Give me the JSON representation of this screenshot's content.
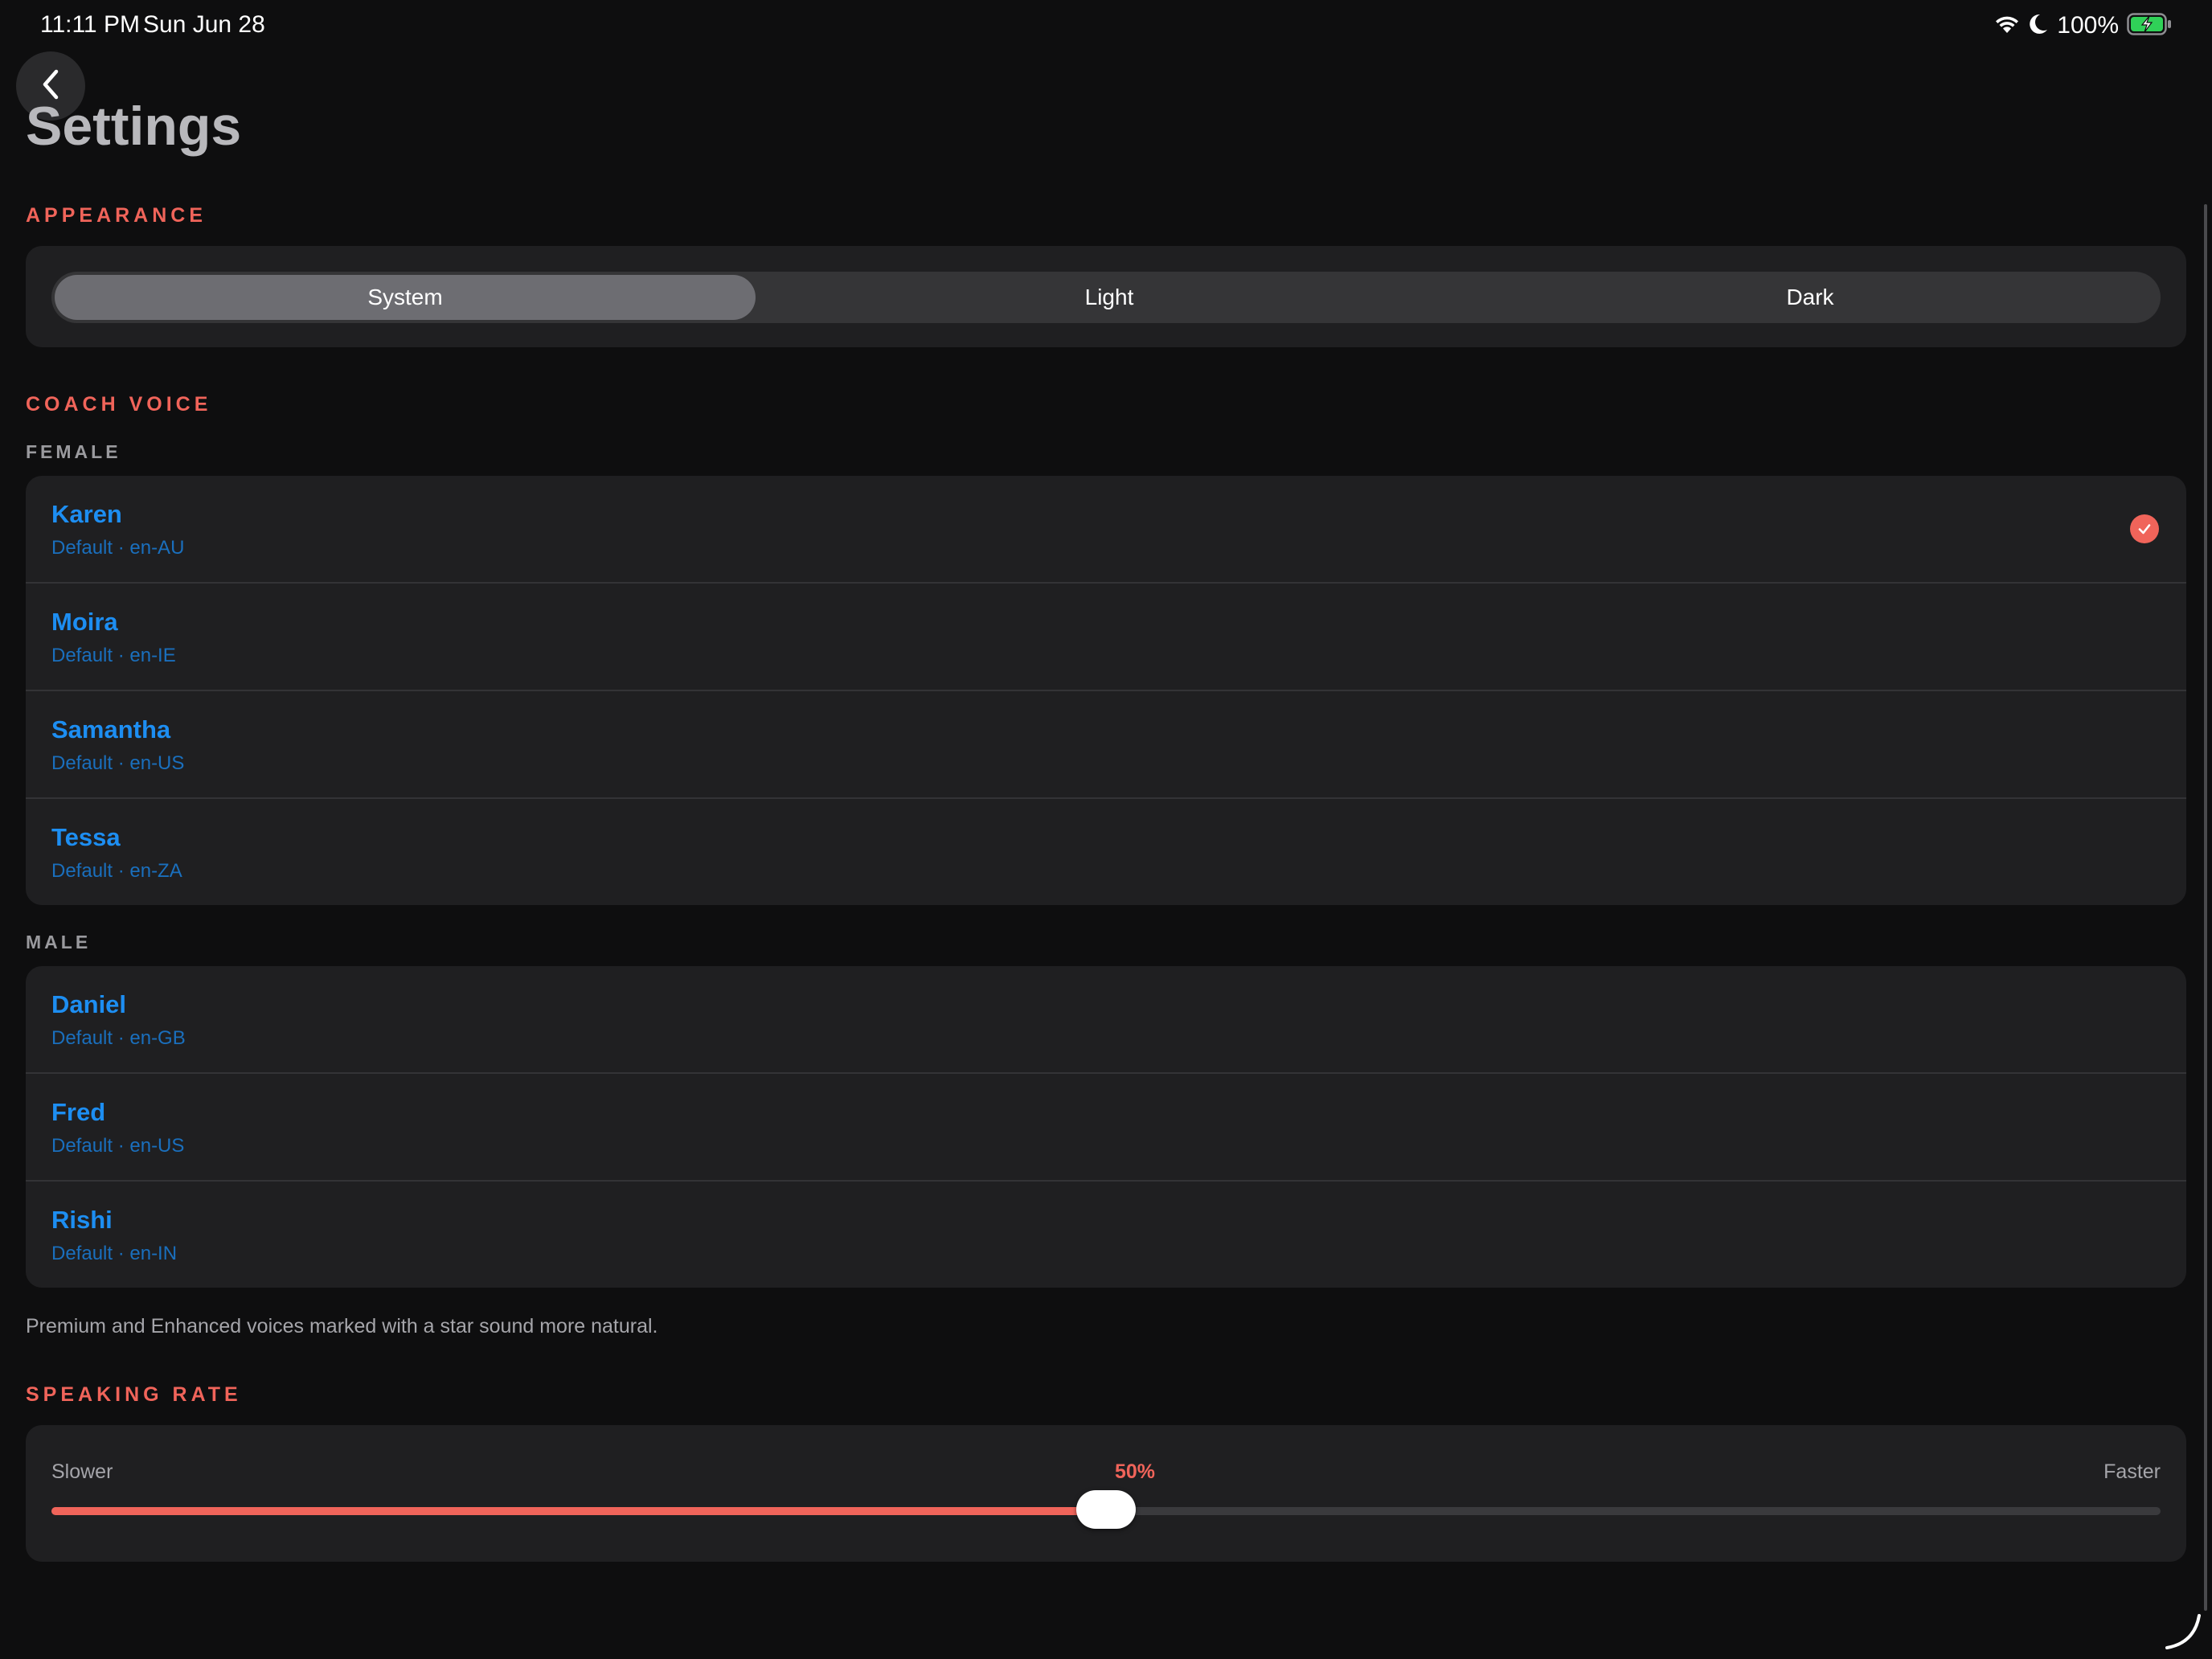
{
  "status_bar": {
    "time": "11:11 PM",
    "date": "Sun Jun 28",
    "battery": "100%",
    "icons": [
      "wifi-icon",
      "moon-icon",
      "battery-charging-icon"
    ]
  },
  "header": {
    "title": "Settings",
    "back_icon": "chevron-left-icon"
  },
  "appearance": {
    "section_label": "APPEARANCE",
    "options": [
      "System",
      "Light",
      "Dark"
    ],
    "selected": "System"
  },
  "coach_voice": {
    "section_label": "COACH VOICE",
    "female_label": "FEMALE",
    "female": [
      {
        "name": "Karen",
        "detail": "Default · en-AU",
        "selected": true
      },
      {
        "name": "Moira",
        "detail": "Default · en-IE",
        "selected": false
      },
      {
        "name": "Samantha",
        "detail": "Default · en-US",
        "selected": false
      },
      {
        "name": "Tessa",
        "detail": "Default · en-ZA",
        "selected": false
      }
    ],
    "male_label": "MALE",
    "male": [
      {
        "name": "Daniel",
        "detail": "Default · en-GB",
        "selected": false
      },
      {
        "name": "Fred",
        "detail": "Default · en-US",
        "selected": false
      },
      {
        "name": "Rishi",
        "detail": "Default · en-IN",
        "selected": false
      }
    ],
    "footnote": "Premium and Enhanced voices marked with a star sound more natural."
  },
  "speaking_rate": {
    "section_label": "SPEAKING RATE",
    "min_label": "Slower",
    "max_label": "Faster",
    "value_label": "50%",
    "value": 0.5
  },
  "colors": {
    "accent": "#f0645a",
    "link": "#1d8ef2",
    "background": "#0e0e0f",
    "card": "#1f1f21"
  }
}
